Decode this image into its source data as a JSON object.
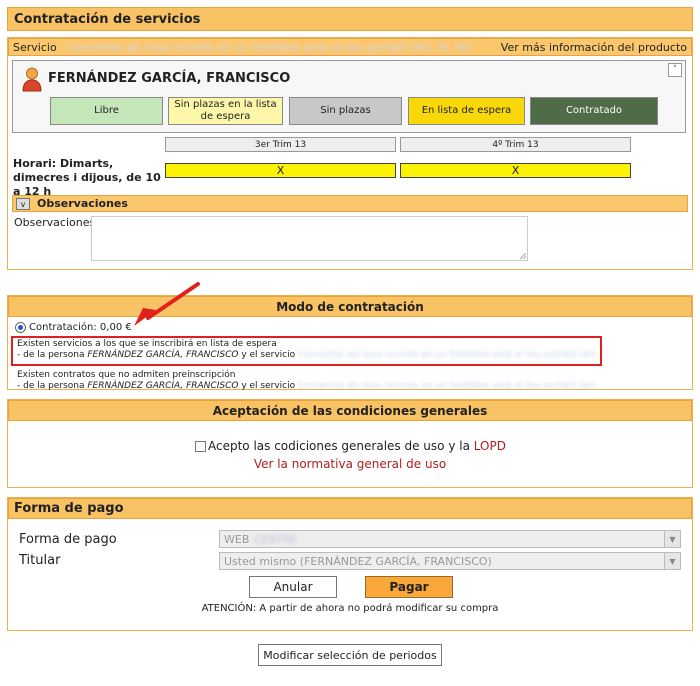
{
  "header": {
    "title": "Contratación de servicios"
  },
  "service_row": {
    "label": "Servicio",
    "name_blurred": "Convertixi als teus records en un fotollibre amb el teu portàtil (4rt, 4t, 4t)",
    "more_info_link": "Ver más información del producto"
  },
  "person": {
    "name": "FERNÁNDEZ GARCÍA, FRANCISCO",
    "collapse_glyph": "˄"
  },
  "legend": [
    {
      "label": "Libre",
      "color": "#c5e6b8"
    },
    {
      "label": "Sin plazas en la lista de espera",
      "color": "#fdf8a9"
    },
    {
      "label": "Sin plazas",
      "color": "#c8c8c8"
    },
    {
      "label": "En lista de espera",
      "color": "#f9d809"
    },
    {
      "label": "Contratado",
      "color": "#4f6b47"
    }
  ],
  "schedule": {
    "periods": [
      "3er Trim 13",
      "4º Trim 13"
    ],
    "label": "Horari: Dimarts, dimecres i dijous, de 10 a 12 h",
    "marks": [
      "X",
      "X"
    ]
  },
  "observaciones": {
    "toggle": "v",
    "title": "Observaciones",
    "field_label": "Observaciones",
    "value": ""
  },
  "modo": {
    "title": "Modo de contratación",
    "contratacion_label": "Contratación: 0,00 €",
    "notice1_line1": "Existen servicios a los que se inscribirá en lista de espera",
    "notice_prefix": "- de la persona",
    "notice_person": "FERNÁNDEZ GARCÍA, FRANCISCO",
    "notice_suffix": "y el servicio",
    "notice1_service_blurred": "Convertixi als teus records en un fotollibre amb el teu portàtil (4rt, 4t, 4t)",
    "notice2_line1": "Existen contratos que no admiten preinscripción",
    "notice2_service_blurred": "Convertixi als teus records en un fotollibre amb el teu portàtil (4rt, 4t, 4t)"
  },
  "condiciones": {
    "title": "Aceptación de las condiciones generales",
    "accept_text": "Acepto las codiciones generales de uso y la",
    "lopd_link": "LOPD",
    "normativa_link": "Ver la normativa general de uso"
  },
  "pago": {
    "title": "Forma de pago",
    "forma_label": "Forma de pago",
    "forma_value": "WEB",
    "forma_value_blurred": "CENTRE",
    "titular_label": "Titular",
    "titular_value": "Usted mismo (FERNÁNDEZ GARCÍA, FRANCISCO)",
    "anular": "Anular",
    "pagar": "Pagar",
    "atencion": "ATENCIÓN: A partir de ahora no podrá modificar su compra"
  },
  "footer": {
    "modificar": "Modificar selección de periodos"
  },
  "colors": {
    "accent": "#f9c265",
    "annotation": "#e0201c",
    "link": "#b01e1e"
  }
}
